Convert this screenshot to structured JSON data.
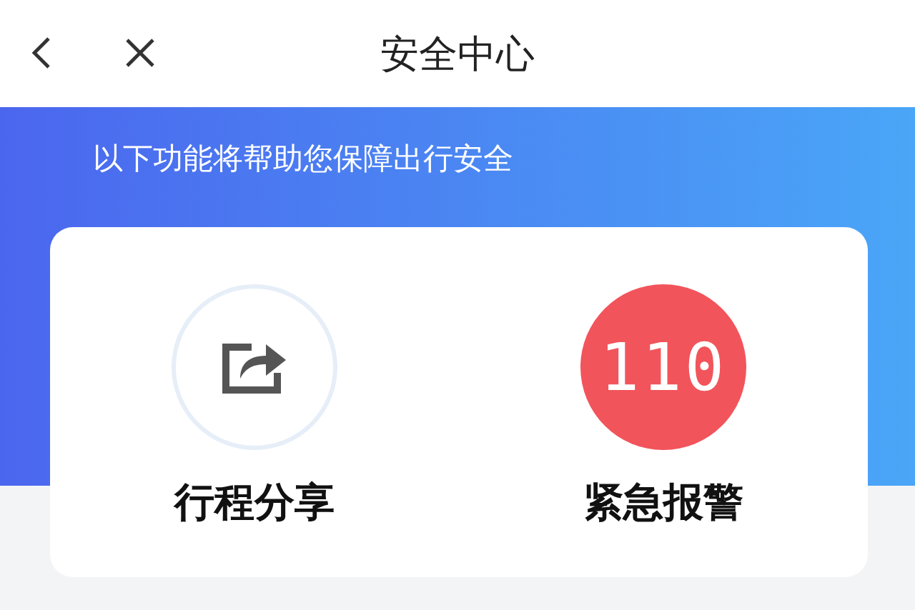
{
  "header": {
    "title": "安全中心"
  },
  "subtitle": "以下功能将帮助您保障出行安全",
  "actions": [
    {
      "kind": "share",
      "label": "行程分享"
    },
    {
      "kind": "emergency",
      "label": "紧急报警",
      "number": "110"
    }
  ]
}
